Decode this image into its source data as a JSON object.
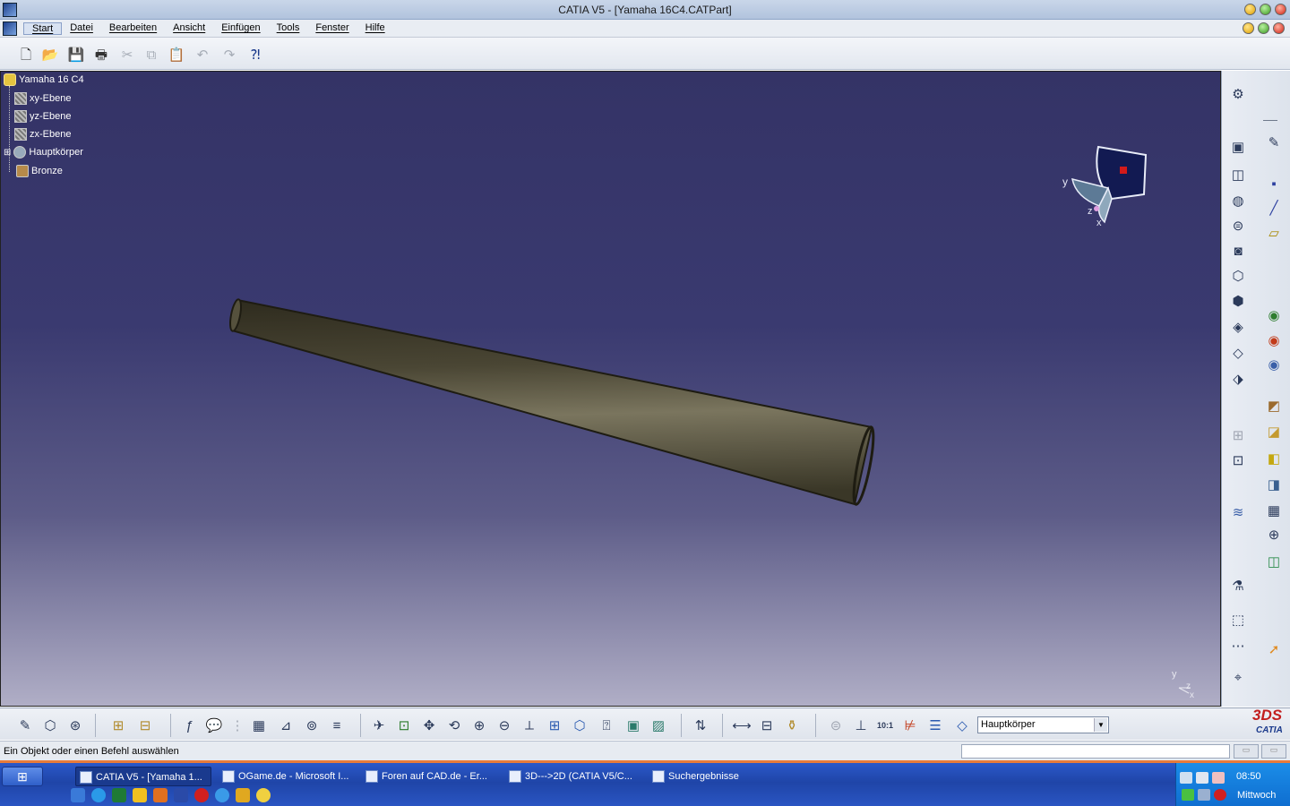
{
  "window": {
    "title": "CATIA V5 - [Yamaha 16C4.CATPart]"
  },
  "menu": {
    "items": [
      "Start",
      "Datei",
      "Bearbeiten",
      "Ansicht",
      "Einfügen",
      "Tools",
      "Fenster",
      "Hilfe"
    ]
  },
  "toolbar_standard": {
    "icons": [
      "new-file-icon",
      "open-folder-icon",
      "save-icon",
      "print-icon",
      "cut-icon",
      "copy-icon",
      "paste-icon",
      "undo-icon",
      "redo-icon",
      "whats-this-help-icon"
    ]
  },
  "tree": {
    "root": "Yamaha 16 C4",
    "nodes": [
      "xy-Ebene",
      "yz-Ebene",
      "zx-Ebene",
      "Hauptkörper",
      "Bronze"
    ]
  },
  "compass": {
    "x_label": "x",
    "y_label": "y",
    "z_label": "z"
  },
  "axis_indicator": {
    "y_label": "y",
    "z_label": "z",
    "x_label": "x"
  },
  "part": {
    "color": "#4a4634",
    "highlight_color": "#7a755e"
  },
  "viewport": {
    "background_top": "#343366",
    "background_bottom": "#b0aec6"
  },
  "bottom_toolbar": {
    "current_body": "Hauptkörper"
  },
  "logo": {
    "mark": "3DS",
    "text": "CATIA"
  },
  "status": {
    "message": "Ein Objekt oder einen Befehl auswählen"
  },
  "taskbar": {
    "tasks": [
      {
        "label": "CATIA V5 - [Yamaha 1...",
        "active": true
      },
      {
        "label": "OGame.de - Microsoft I...",
        "active": false
      },
      {
        "label": "Foren auf CAD.de - Er...",
        "active": false
      },
      {
        "label": "3D--->2D (CATIA V5/C...",
        "active": false
      },
      {
        "label": "Suchergebnisse",
        "active": false
      }
    ],
    "clock": "08:50",
    "day": "Mittwoch"
  }
}
